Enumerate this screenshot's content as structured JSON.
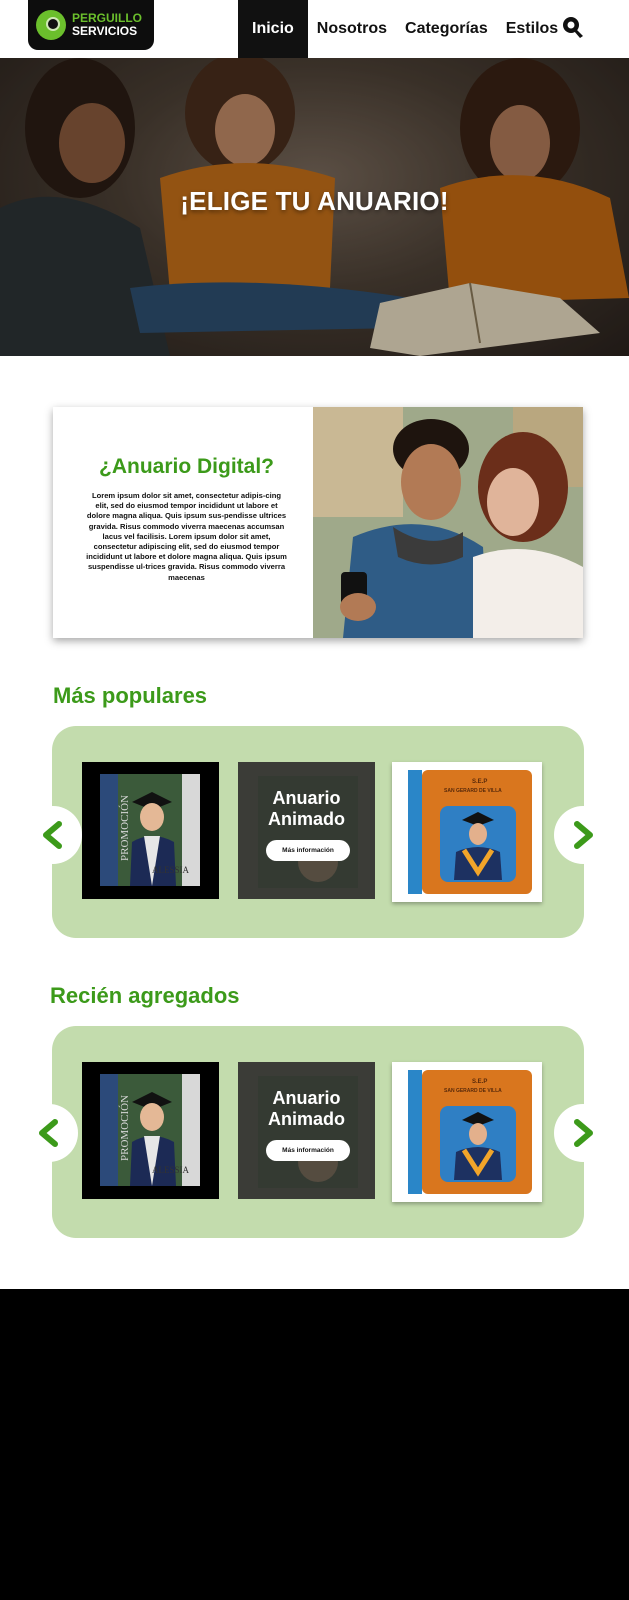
{
  "brand": {
    "line1": "PERGUILLO",
    "line2": "SERVICIOS",
    "accent": "#3c9a1a",
    "dark": "#111111",
    "panel": "#c3dcad"
  },
  "nav": {
    "items": [
      "Inicio",
      "Nosotros",
      "Categorías",
      "Estilos"
    ],
    "active": "Inicio",
    "search_icon": "search-icon"
  },
  "hero": {
    "title": "¡ELIGE TU ANUARIO!"
  },
  "digital": {
    "title": "¿Anuario Digital?",
    "body": "Lorem ipsum dolor sit amet, consectetur adipis-cing elit, sed do eiusmod tempor incididunt ut labore et dolore magna aliqua. Quis ipsum sus-pendisse ultrices gravida. Risus commodo viverra maecenas accumsan lacus vel facilisis. Lorem ipsum dolor sit amet, consectetur adipiscing elit, sed do eiusmod tempor incididunt ut labore et dolore magna aliqua. Quis ipsum suspendisse ul-trices gravida. Risus commodo viverra maecenas"
  },
  "popular": {
    "title": "Más populares",
    "cards": [
      {
        "label": "PROMOCIÓN",
        "name": "ALESSIA"
      },
      {
        "title": "Anuario Animado",
        "button": "Más información"
      },
      {
        "school": "S.E.P",
        "school_name": "SAN GERARD DE VILLA"
      }
    ]
  },
  "recent": {
    "title": "Recién agregados",
    "cards": [
      {
        "label": "PROMOCIÓN",
        "name": "ALESSIA"
      },
      {
        "title": "Anuario Animado",
        "button": "Más información"
      },
      {
        "school": "S.E.P",
        "school_name": "SAN GERARD DE VILLA"
      }
    ]
  }
}
